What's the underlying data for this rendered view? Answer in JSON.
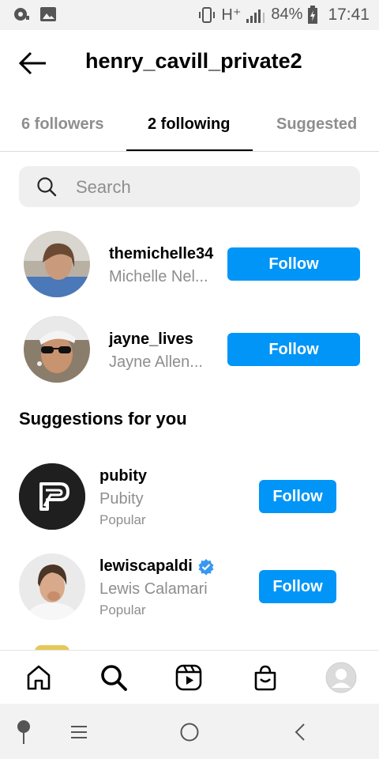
{
  "status_bar": {
    "network": "H⁺",
    "battery": "84%",
    "time": "17:41"
  },
  "header": {
    "title": "henry_cavill_private2"
  },
  "tabs": [
    {
      "label": "6 followers",
      "active": false
    },
    {
      "label": "2 following",
      "active": true
    },
    {
      "label": "Suggested",
      "active": false
    }
  ],
  "search": {
    "placeholder": "Search"
  },
  "following": [
    {
      "username": "themichelle34",
      "full_name": "Michelle Nel...",
      "button": "Follow"
    },
    {
      "username": "jayne_lives",
      "full_name": "Jayne Allen...",
      "button": "Follow"
    }
  ],
  "suggestions": {
    "title": "Suggestions for you",
    "items": [
      {
        "username": "pubity",
        "full_name": "Pubity",
        "subtitle": "Popular",
        "button": "Follow",
        "verified": false
      },
      {
        "username": "lewiscapaldi",
        "full_name": "Lewis Calamari",
        "subtitle": "Popular",
        "button": "Follow",
        "verified": true
      }
    ]
  },
  "colors": {
    "accent": "#0095f6",
    "muted_text": "#8e8e8e",
    "search_bg": "#efefef"
  },
  "icons": {
    "bottom_nav": [
      "home-icon",
      "search-icon",
      "reels-icon",
      "shop-icon",
      "profile-avatar"
    ],
    "android": [
      "recent-apps-icon",
      "home-circle-icon",
      "back-chevron-icon"
    ]
  }
}
